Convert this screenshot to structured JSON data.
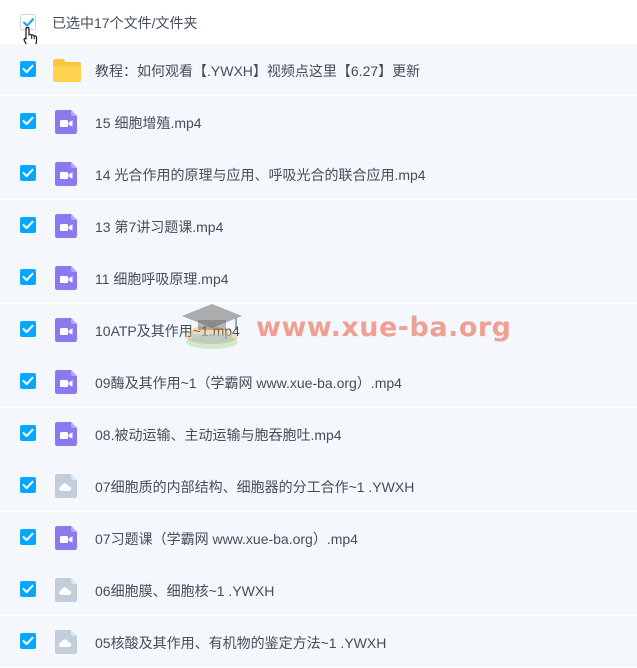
{
  "header": {
    "selection_text": "已选中17个文件/文件夹"
  },
  "colors": {
    "accent": "#06a7ff",
    "row_bg": "#f4f8fd",
    "video_icon": "#8b79f2",
    "folder_icon": "#ffd252",
    "cloud_icon": "#c2cedb",
    "watermark": "#ec563c"
  },
  "files": [
    {
      "name": "教程：如何观看【.YWXH】视频点这里【6.27】更新",
      "icon": "folder-icon",
      "checked": true
    },
    {
      "name": "15 细胞增殖.mp4",
      "icon": "video-file-icon",
      "checked": true
    },
    {
      "name": "14 光合作用的原理与应用、呼吸光合的联合应用.mp4",
      "icon": "video-file-icon",
      "checked": true
    },
    {
      "name": "13 第7讲习题课.mp4",
      "icon": "video-file-icon",
      "checked": true
    },
    {
      "name": "11 细胞呼吸原理.mp4",
      "icon": "video-file-icon",
      "checked": true
    },
    {
      "name": "10ATP及其作用~1.mp4",
      "icon": "video-file-icon",
      "checked": true
    },
    {
      "name": "09酶及其作用~1（学霸网 www.xue-ba.org）.mp4",
      "icon": "video-file-icon",
      "checked": true
    },
    {
      "name": "08.被动运输、主动运输与胞吞胞吐.mp4",
      "icon": "video-file-icon",
      "checked": true
    },
    {
      "name": "07细胞质的内部结构、细胞器的分工合作~1 .YWXH",
      "icon": "cloud-file-icon",
      "checked": true
    },
    {
      "name": "07习题课（学霸网 www.xue-ba.org）.mp4",
      "icon": "video-file-icon",
      "checked": true
    },
    {
      "name": "06细胞膜、细胞核~1 .YWXH",
      "icon": "cloud-file-icon",
      "checked": true
    },
    {
      "name": "05核酸及其作用、有机物的鉴定方法~1 .YWXH",
      "icon": "cloud-file-icon",
      "checked": true
    }
  ],
  "watermark": {
    "text": "www.xue-ba.org"
  }
}
